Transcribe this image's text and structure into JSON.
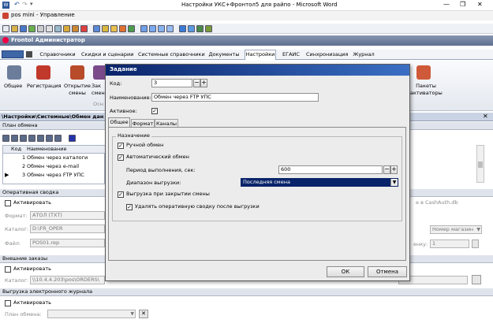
{
  "word": {
    "title": "Настройки УКС+Фронтол5 для райпо  -  Microsoft Word",
    "win_controls": [
      "—",
      "❐",
      "✕"
    ]
  },
  "app": {
    "title": "pos mini - Управление",
    "header_title": "Frontol Администратор",
    "tabs": [
      "Справочники",
      "Скидки и сценарии",
      "Системные справочники",
      "Документы",
      "Настройки",
      "ЕГАИС",
      "Синхронизация",
      "Журнал"
    ],
    "active_tab": "Настройки",
    "ribbon": {
      "buttons": [
        "Общее",
        "Регистрация",
        "Открытие смены",
        "Зак смены"
      ],
      "group_label": "Осн",
      "right_button": "Пакеты активаторы"
    },
    "breadcrumb": "\\Настройки\\Системные\\Обмен дан"
  },
  "exchange_plan": {
    "section_title": "План обмена",
    "columns": [
      "Код",
      "Наименование"
    ],
    "rows": [
      {
        "code": "1",
        "name": "Обмен через каталоги"
      },
      {
        "code": "2",
        "name": "Обмен через e-mail"
      },
      {
        "code": "3",
        "name": "Обмен через FTP УПС"
      }
    ]
  },
  "operative": {
    "section_title": "Оперативная сводка",
    "activate_label": "Активировать",
    "format_label": "Формат:",
    "format_value": "АТОЛ (TXT)",
    "catalog_label": "Каталог:",
    "catalog_value": "D:\\FR_OPER",
    "file_label": "Файл:",
    "file_value": "POS01.rep",
    "right_text": "е в CashAuth.db",
    "right_select": "Номер магазин",
    "right_label": "енку:",
    "right_value": "1"
  },
  "external_orders": {
    "section_title": "Внешние заказы",
    "activate_label": "Активировать",
    "catalog_label": "Каталог:",
    "catalog_value": "\\\\10.4.4.203\\pos\\ORDERS\\"
  },
  "ejournal": {
    "section_title": "Выгрузка электронного журнала",
    "activate_label": "Активировать",
    "plan_label": "План обмена:"
  },
  "dialog": {
    "title": "Задание",
    "code_label": "Код:",
    "code_value": "3",
    "name_label": "Наименование:",
    "name_value": "Обмен через FTP УПС",
    "active_label": "Активное:",
    "tabs": [
      "Общее",
      "Формат",
      "Каналы"
    ],
    "purpose_label": "Назначение",
    "manual_label": "Ручной обмен",
    "auto_label": "Автоматический обмен",
    "period_label": "Период выполнения, сек:",
    "period_value": "600",
    "range_label": "Диапазон выгрузки:",
    "range_value": "Последняя смена",
    "close_shift_label": "Выгрузка при закрытии смены",
    "delete_label": "Удалять оперативную сводку после выгрузки",
    "ok_label": "ОК",
    "cancel_label": "Отмена"
  },
  "colors": {
    "dialog_title": "#3b6fc4",
    "selection": "#0a246a",
    "frontol_header": "#6e7f9d"
  }
}
